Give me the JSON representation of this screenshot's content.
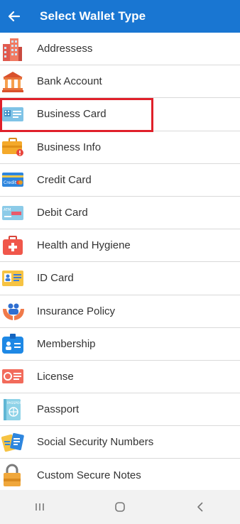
{
  "header": {
    "title": "Select Wallet Type",
    "back_icon": "arrow-left-icon"
  },
  "items": [
    {
      "label": "Addressess",
      "icon": "building-icon"
    },
    {
      "label": "Bank Account",
      "icon": "bank-icon"
    },
    {
      "label": "Business Card",
      "icon": "business-card-icon",
      "selected": true
    },
    {
      "label": "Business Info",
      "icon": "briefcase-icon"
    },
    {
      "label": "Credit Card",
      "icon": "credit-card-icon"
    },
    {
      "label": "Debit Card",
      "icon": "debit-card-icon"
    },
    {
      "label": "Health and Hygiene",
      "icon": "first-aid-kit-icon"
    },
    {
      "label": "ID Card",
      "icon": "id-card-icon"
    },
    {
      "label": "Insurance Policy",
      "icon": "insurance-hands-icon"
    },
    {
      "label": "Membership",
      "icon": "membership-badge-icon"
    },
    {
      "label": "License",
      "icon": "license-icon"
    },
    {
      "label": "Passport",
      "icon": "passport-icon"
    },
    {
      "label": "Social Security Numbers",
      "icon": "ssn-cards-icon"
    },
    {
      "label": "Custom Secure Notes",
      "icon": "padlock-icon"
    }
  ],
  "navbar": {
    "recent": "recent-apps-icon",
    "home": "home-icon",
    "back": "back-nav-icon"
  },
  "colors": {
    "appbar": "#1976d2",
    "highlight": "#e0202a"
  }
}
